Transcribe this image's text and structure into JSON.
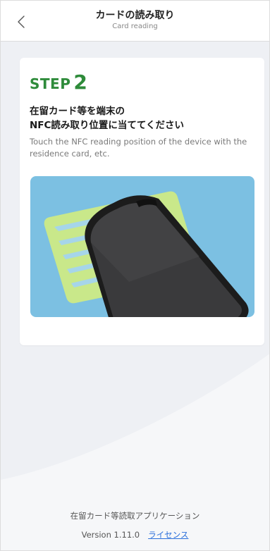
{
  "header": {
    "title": "カードの読み取り",
    "subtitle": "Card reading",
    "back_icon": "chevron-left-icon"
  },
  "step": {
    "word": "STEP",
    "number": "2",
    "title_line1": "在留カード等を端末の",
    "title_line2": "NFC読み取り位置に当ててください",
    "description": "Touch the NFC reading position of the device with the residence card, etc."
  },
  "illustration": {
    "semantic": "phone-touching-residence-card"
  },
  "footer": {
    "app_name": "在留カード等読取アプリケーション",
    "version": "Version 1.11.0",
    "license_link": "ライセンス"
  },
  "colors": {
    "step_green": "#2e8b3a",
    "link_blue": "#2a6fdb",
    "illustration_bg": "#7cc0e2",
    "card_yellow": "#c9e88a",
    "background": "#eef0f4"
  }
}
